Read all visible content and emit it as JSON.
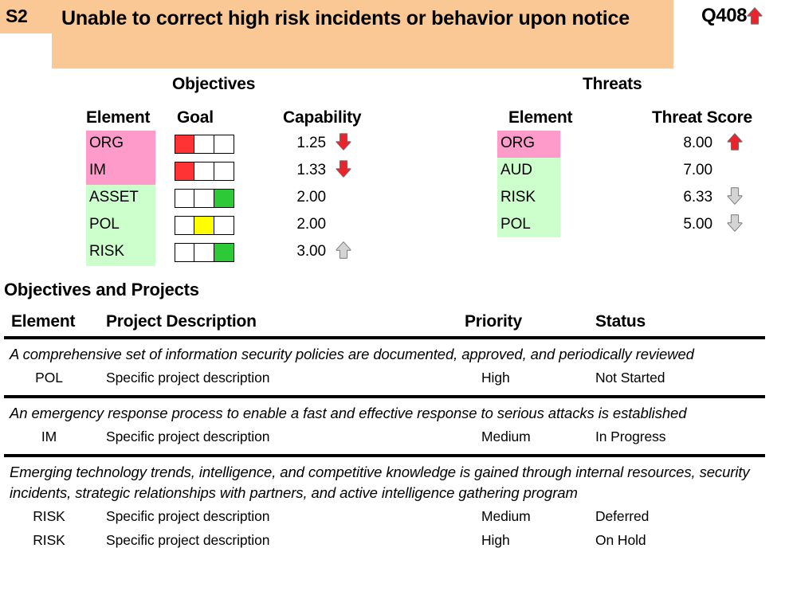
{
  "header": {
    "code": "S2",
    "title": "Unable to correct high risk incidents or behavior upon notice",
    "quarter": "Q408",
    "quarter_trend": "arrow-up-red",
    "bg_color": "#fac895"
  },
  "objectives": {
    "panel_title": "Objectives",
    "columns": {
      "element": "Element",
      "goal": "Goal",
      "capability": "Capability"
    },
    "rows": [
      {
        "element": "ORG",
        "element_bg": "#ff9bcb",
        "goal_cells": [
          "#ff3333",
          "#ffffff",
          "#ffffff"
        ],
        "capability": "1.25",
        "trend": "arrow-down-red"
      },
      {
        "element": "IM",
        "element_bg": "#ff9bcb",
        "goal_cells": [
          "#ff3333",
          "#ffffff",
          "#ffffff"
        ],
        "capability": "1.33",
        "trend": "arrow-down-red"
      },
      {
        "element": "ASSET",
        "element_bg": "#ccffcc",
        "goal_cells": [
          "#ffffff",
          "#ffffff",
          "#2dc937"
        ],
        "capability": "2.00",
        "trend": "none"
      },
      {
        "element": "POL",
        "element_bg": "#ccffcc",
        "goal_cells": [
          "#ffffff",
          "#ffff00",
          "#ffffff"
        ],
        "capability": "2.00",
        "trend": "none"
      },
      {
        "element": "RISK",
        "element_bg": "#ccffcc",
        "goal_cells": [
          "#ffffff",
          "#ffffff",
          "#2dc937"
        ],
        "capability": "3.00",
        "trend": "arrow-up-gray"
      }
    ]
  },
  "threats": {
    "panel_title": "Threats",
    "columns": {
      "element": "Element",
      "threat_score": "Threat Score"
    },
    "rows": [
      {
        "element": "ORG",
        "element_bg": "#ff9bcb",
        "score": "8.00",
        "trend": "arrow-up-red"
      },
      {
        "element": "AUD",
        "element_bg": "#ccffcc",
        "score": "7.00",
        "trend": "none"
      },
      {
        "element": "RISK",
        "element_bg": "#ccffcc",
        "score": "6.33",
        "trend": "arrow-down-gray"
      },
      {
        "element": "POL",
        "element_bg": "#ccffcc",
        "score": "5.00",
        "trend": "arrow-down-gray"
      }
    ]
  },
  "projects": {
    "section_title": "Objectives and Projects",
    "columns": {
      "element": "Element",
      "description": "Project Description",
      "priority": "Priority",
      "status": "Status"
    },
    "groups": [
      {
        "objective": "A comprehensive set of information security policies are documented, approved, and periodically reviewed",
        "rows": [
          {
            "element": "POL",
            "description": "Specific project description",
            "priority": "High",
            "status": "Not Started"
          }
        ]
      },
      {
        "objective": "An emergency response process to enable a fast and effective response to serious attacks is established",
        "rows": [
          {
            "element": "IM",
            "description": "Specific project description",
            "priority": "Medium",
            "status": "In Progress"
          }
        ]
      },
      {
        "objective": "Emerging technology trends, intelligence, and competitive knowledge is gained through internal resources, security incidents, strategic relationships with partners, and active intelligence gathering program",
        "rows": [
          {
            "element": "RISK",
            "description": "Specific project description",
            "priority": "Medium",
            "status": "Deferred"
          },
          {
            "element": "RISK",
            "description": "Specific project description",
            "priority": "High",
            "status": "On Hold"
          }
        ]
      }
    ]
  },
  "colors": {
    "header_orange": "#fac895",
    "pink": "#ff9bcb",
    "light_green": "#ccffcc",
    "red": "#ff3333",
    "green": "#2dc937",
    "yellow": "#ffff00",
    "arrow_gray": "#a6a6a6",
    "arrow_red": "#e8252a"
  }
}
